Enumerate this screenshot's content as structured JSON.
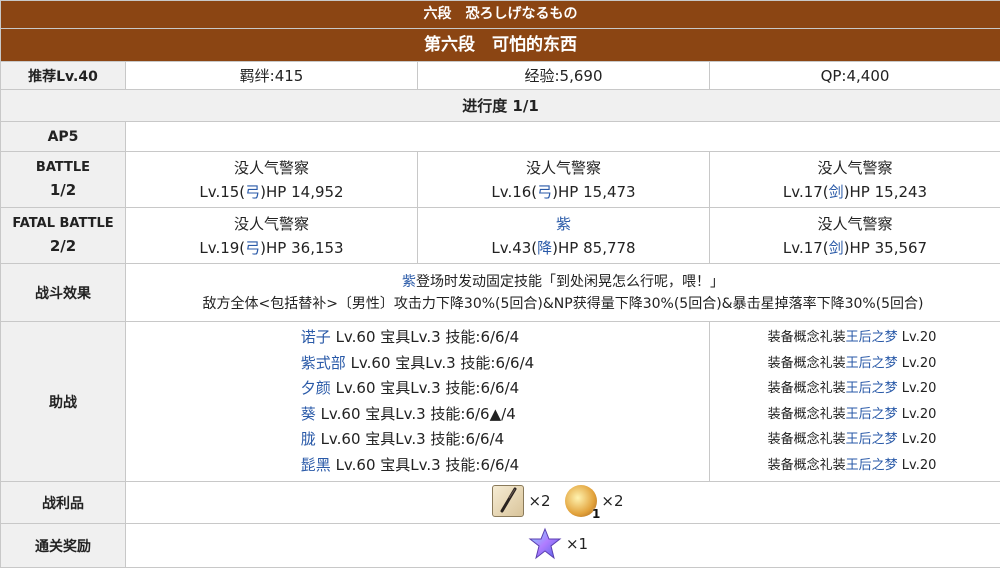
{
  "title": {
    "jp": "六段　恐ろしげなるもの",
    "cn": "第六段　可怕的东西"
  },
  "info": {
    "recommend": "推荐Lv.40",
    "bond": "羁绊:415",
    "exp": "经验:5,690",
    "qp": "QP:4,400"
  },
  "progress": "进行度 1/1",
  "ap": {
    "label": "AP5"
  },
  "battle1": {
    "label1": "BATTLE",
    "label2": "1/2",
    "enemies": [
      {
        "name": "没人气警察",
        "lv": "Lv.15(",
        "cls": "弓",
        "hp": ")HP 14,952"
      },
      {
        "name": "没人气警察",
        "lv": "Lv.16(",
        "cls": "弓",
        "hp": ")HP 15,473"
      },
      {
        "name": "没人气警察",
        "lv": "Lv.17(",
        "cls": "剑",
        "hp": ")HP 15,243"
      }
    ]
  },
  "battle2": {
    "label1": "FATAL BATTLE",
    "label2": "2/2",
    "enemies": [
      {
        "name": "没人气警察",
        "lv": "Lv.19(",
        "cls": "弓",
        "hp": ")HP 36,153"
      },
      {
        "name": "紫",
        "lv": "Lv.43(",
        "cls": "降",
        "hp": ")HP 85,778"
      },
      {
        "name": "没人气警察",
        "lv": "Lv.17(",
        "cls": "剑",
        "hp": ")HP 35,567"
      }
    ]
  },
  "effect": {
    "label": "战斗效果",
    "line1_name": "紫",
    "line1_text": "登场时发动固定技能「到处闲晃怎么行呢，喂！」",
    "line2": "敌方全体<包括替补>〔男性〕攻击力下降30%(5回合)&NP获得量下降30%(5回合)&暴击星掉落率下降30%(5回合)"
  },
  "support": {
    "label": "助战",
    "servants": [
      {
        "name": "诺子",
        "info": " Lv.60 宝具Lv.3 技能:6/6/4"
      },
      {
        "name": "紫式部",
        "info": " Lv.60 宝具Lv.3 技能:6/6/4"
      },
      {
        "name": "夕颜",
        "info": " Lv.60 宝具Lv.3 技能:6/6/4"
      },
      {
        "name": "葵",
        "info": " Lv.60 宝具Lv.3 技能:6/6▲/4"
      },
      {
        "name": "胧",
        "info": " Lv.60 宝具Lv.3 技能:6/6/4"
      },
      {
        "name": "髭黑",
        "info": " Lv.60 宝具Lv.3 技能:6/6/4"
      }
    ],
    "ce": [
      {
        "prefix": "装备概念礼装",
        "name": "王后之梦",
        "lv": " Lv.20"
      },
      {
        "prefix": "装备概念礼装",
        "name": "王后之梦",
        "lv": " Lv.20"
      },
      {
        "prefix": "装备概念礼装",
        "name": "王后之梦",
        "lv": " Lv.20"
      },
      {
        "prefix": "装备概念礼装",
        "name": "王后之梦",
        "lv": " Lv.20"
      },
      {
        "prefix": "装备概念礼装",
        "name": "王后之梦",
        "lv": " Lv.20"
      },
      {
        "prefix": "装备概念礼装",
        "name": "王后之梦",
        "lv": " Lv.20"
      }
    ]
  },
  "drops": {
    "label": "战利品",
    "items": [
      {
        "icon": "feather-icon",
        "qty": "×2"
      },
      {
        "icon": "gem-icon",
        "badge": "1",
        "qty": "×2"
      }
    ]
  },
  "reward": {
    "label": "通关奖励",
    "items": [
      {
        "icon": "saint-quartz-icon",
        "qty": "×1"
      }
    ]
  },
  "colors": {
    "header": "#8b4513",
    "link": "#2a5aa8",
    "label_bg": "#f0f0f0"
  }
}
